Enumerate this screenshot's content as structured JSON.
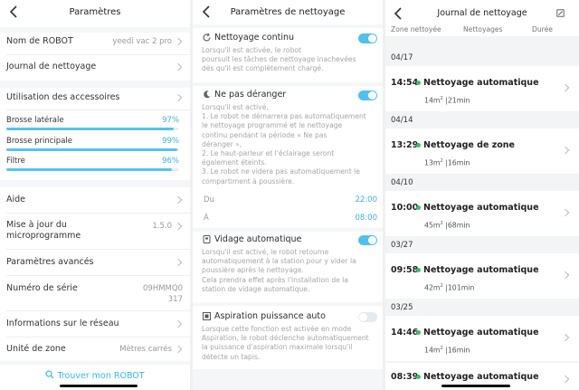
{
  "settings": {
    "title": "Paramètres",
    "robot_name_label": "Nom de ROBOT",
    "robot_name_value": "yeedi vac 2 pro",
    "journal_label": "Journal de nettoyage",
    "accessories_label": "Utilisation des accessoires",
    "accessories": [
      {
        "label": "Brosse latérale",
        "percent_text": "97%",
        "percent": 97
      },
      {
        "label": "Brosse principale",
        "percent_text": "99%",
        "percent": 99
      },
      {
        "label": "Filtre",
        "percent_text": "96%",
        "percent": 96
      }
    ],
    "help_label": "Aide",
    "firmware_label_line1": "Mise à jour du",
    "firmware_label_line2": "microprogramme",
    "firmware_value": "1.5.0",
    "advanced_label": "Paramètres avancés",
    "serial_label": "Numéro de série",
    "serial_value_line1": "09HMMQ0",
    "serial_value_line2": "317",
    "network_label": "Informations sur le réseau",
    "unit_label": "Unité de zone",
    "unit_value": "Mètres carrés",
    "find_robot_label": "Trouver mon ROBOT"
  },
  "cleaning": {
    "title": "Paramètres de nettoyage",
    "continuous": {
      "title": "Nettoyage continu",
      "desc": "Lorsqu'il est activée, le robot\npoursuit les tâches de nettoyage inachevées\ndès qu'il est complètement chargé.",
      "enabled": true
    },
    "dnd": {
      "title": "Ne pas déranger",
      "desc": "Lorsqu'il est activé,\n1. Le robot ne démarrera pas automatiquement\nle nettoyage programmé et le nettoyage\ncontinu pendant la période « Ne pas\ndéranger »,\n2. Le haut-parleur et l'éclairage seront\négalement éteints.\n 3. Le robot ne videra pas automatiquement le\ncompartiment à poussière.",
      "enabled": true,
      "from_label": "Du",
      "from_time": "22:00",
      "to_label": "À",
      "to_time": "08:00"
    },
    "auto_empty": {
      "title": "Vidage automatique",
      "desc": "Lorsqu'il est activé, le robot retourne\nautomatiquement à la station pour y vider la\npoussière après le nettoyage.\nCela prendra effet après l'installation de la\nstation de vidage automatique.",
      "enabled": true
    },
    "suction": {
      "title": "Aspiration puissance auto",
      "desc": "Lorsque cette fonction est activée en mode\nAspiration, le robot déclenche automatiquement\nla puissance d'aspiration maximale lorsqu'il\ndétecte un tapis.",
      "enabled": false
    }
  },
  "journal": {
    "title": "Journal de nettoyage",
    "columns": [
      "Zone nettoyée",
      "Nettoyages",
      "Durée"
    ],
    "groups": [
      {
        "date": "04/17",
        "entries": [
          {
            "time": "14:54",
            "name": "Nettoyage automatique",
            "area": "14m",
            "duration": "|21min"
          }
        ]
      },
      {
        "date": "04/14",
        "entries": [
          {
            "time": "13:29",
            "name": "Nettoyage de zone",
            "area": "13m",
            "duration": "|16min"
          }
        ]
      },
      {
        "date": "04/10",
        "entries": [
          {
            "time": "10:00",
            "name": "Nettoyage automatique",
            "area": "45m",
            "duration": "|68min"
          }
        ]
      },
      {
        "date": "03/27",
        "entries": [
          {
            "time": "09:58",
            "name": "Nettoyage automatique",
            "area": "42m",
            "duration": "|101min"
          }
        ]
      },
      {
        "date": "03/25",
        "entries": [
          {
            "time": "14:46",
            "name": "Nettoyage automatique",
            "area": "14m",
            "duration": "|16min"
          },
          {
            "time": "08:39",
            "name": "Nettoyage automatique",
            "area": "",
            "duration": ""
          }
        ]
      }
    ],
    "area_unit_sup": "2"
  },
  "colors": {
    "accent": "#3ab0e8",
    "toggle_on": "#52c0ee",
    "dot": "#33c26a"
  }
}
